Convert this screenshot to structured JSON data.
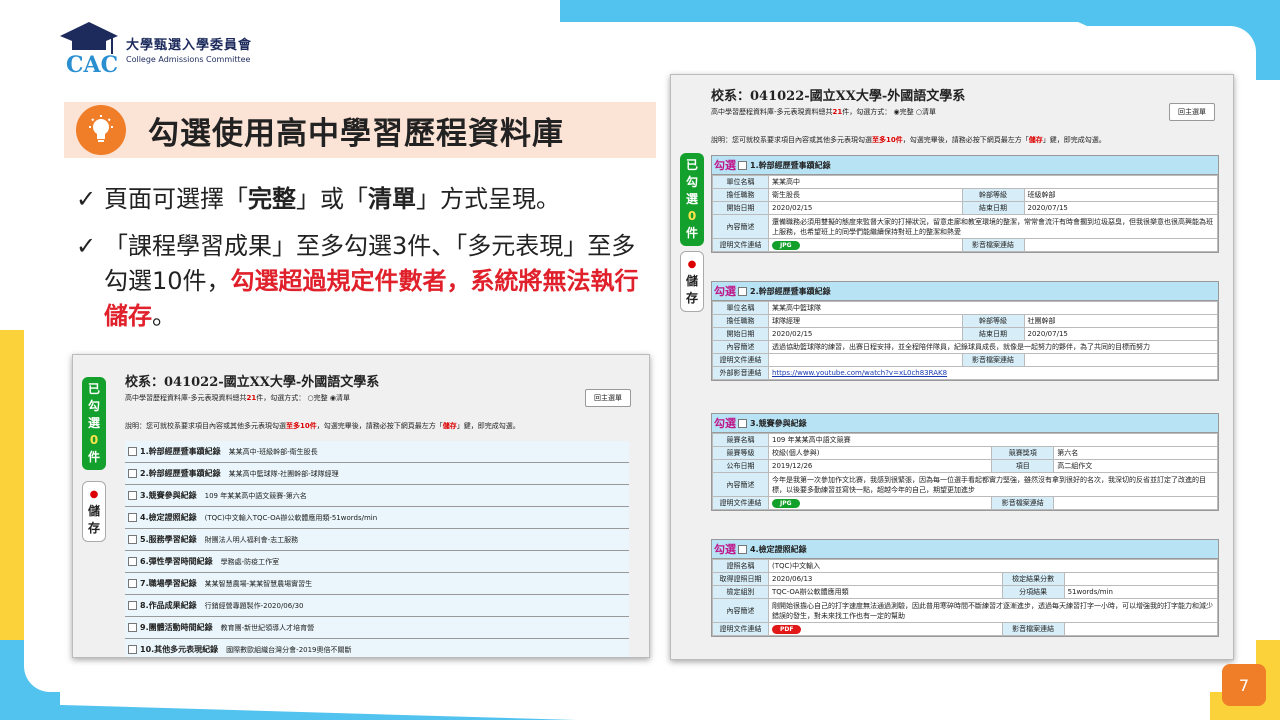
{
  "logo": {
    "zh": "大學甄選入學委員會",
    "en": "College Admissions Committee",
    "mark": "CAC"
  },
  "title": "勾選使用高中學習歷程資料庫",
  "bullets": {
    "b1_pre": "頁面可選擇「",
    "b1_a": "完整",
    "b1_mid": "」或「",
    "b1_b": "清單",
    "b1_post": "」方式呈現。",
    "b2_pre": "「課程學習成果」至多勾選3件、「多元表現」至多勾選10件，",
    "b2_red": "勾選超過規定件數者，系統將無法執行儲存",
    "b2_post": "。"
  },
  "side": {
    "selected_line1": "已",
    "selected_line2": "勾",
    "selected_line3": "選",
    "count": "0",
    "unit": "件",
    "save_dot": "●",
    "save1": "儲",
    "save2": "存"
  },
  "shot1": {
    "title": "校系：041022-國立XX大學-外國語文學系",
    "sub_pre": "高中學習歷程資料庫-多元表現資料總共",
    "sub_count": "21",
    "sub_post": "件，勾選方式：",
    "opt_full": "完整",
    "opt_list": "清單",
    "back": "回主選單",
    "note_pre": "說明：您可就校系要求項目內容或其他多元表現勾選",
    "note_red1": "至多10件",
    "note_mid": "，勾選完畢後，請務必按下網頁最左方「",
    "note_red2": "儲存",
    "note_post": "」鍵，即完成勾選。",
    "rows": [
      {
        "name": "1.幹部經歷暨事蹟紀錄",
        "desc": "某某高中-班級幹部-衛生股長"
      },
      {
        "name": "2.幹部經歷暨事蹟紀錄",
        "desc": "某某高中籃球隊-社團幹部-球隊經理"
      },
      {
        "name": "3.競賽參與紀錄",
        "desc": "109 年某某高中語文競賽-第六名"
      },
      {
        "name": "4.檢定證照紀錄",
        "desc": "(TQC)中文輸入TQC-OA辦公軟體應用類-51words/min"
      },
      {
        "name": "5.服務學習紀錄",
        "desc": "財團法人明人福利會-志工服務"
      },
      {
        "name": "6.彈性學習時間紀錄",
        "desc": "學務處-防疫工作室"
      },
      {
        "name": "7.職場學習紀錄",
        "desc": "某某智慧農場-某某智慧農場實習生"
      },
      {
        "name": "8.作品成果紀錄",
        "desc": "行銷經營專題製作-2020/06/30"
      },
      {
        "name": "9.團體活動時間紀錄",
        "desc": "教育團-新世紀領導人才培育營"
      },
      {
        "name": "10.其他多元表現紀錄",
        "desc": "國際數歐組織台灣分會-2019奧倍不關斷"
      }
    ]
  },
  "shot2": {
    "title": "校系：041022-國立XX大學-外國語文學系",
    "sub_pre": "高中學習歷程資料庫-多元表現資料總共",
    "sub_count": "21",
    "sub_post": "件，勾選方式：",
    "opt_full": "完整",
    "opt_list": "清單",
    "back": "回主選單",
    "note_pre": "說明：您可就校系要求項目內容或其他多元表現勾選",
    "note_red1": "至多10件",
    "note_mid": "，勾選完畢後，請務必按下網頁最左方「",
    "note_red2": "儲存",
    "note_post": "」鍵，即完成勾選。",
    "check_label": "勾選",
    "s1": {
      "head": "1.幹部經歷暨事蹟紀錄",
      "k_unit": "單位名稱",
      "v_unit": "某某高中",
      "k_role": "擔任職務",
      "v_role": "衛生股長",
      "k_level": "幹部等級",
      "v_level": "班級幹部",
      "k_start": "開始日期",
      "v_start": "2020/02/15",
      "k_end": "結束日期",
      "v_end": "2020/07/15",
      "k_desc": "內容簡述",
      "v_desc": "還備職務必須用雙擬的態度來監督大家的打掃狀況，留意走廊和教室環境的整潔，常常會流汗有時會擱到垃圾惡臭，但我很樂意也很高興能為班上服務，也希望班上的同學們能繼續保持對班上的整潔和熱愛",
      "k_doc": "證明文件連結",
      "v_doc": "JPG",
      "k_media": "影音檔案連結"
    },
    "s2": {
      "head": "2.幹部經歷暨事蹟紀錄",
      "k_unit": "單位名稱",
      "v_unit": "某某高中籃球隊",
      "k_role": "擔任職務",
      "v_role": "球隊經理",
      "k_level": "幹部等級",
      "v_level": "社團幹部",
      "k_start": "開始日期",
      "v_start": "2020/02/15",
      "k_end": "結束日期",
      "v_end": "2020/07/15",
      "k_desc": "內容簡述",
      "v_desc": "透過協助籃球隊的練習，出賽日程安排，並全程陪伴隊員，紀錄球員成長，就像是一起努力的夥伴，為了共同的目標而努力",
      "k_doc": "證明文件連結",
      "k_media": "影音檔案連結",
      "k_ext": "外部影音連結",
      "v_ext": "https://www.youtube.com/watch?v=xL0ch83RAK8"
    },
    "s3": {
      "head": "3.競賽參與紀錄",
      "k_name": "競賽名稱",
      "v_name": "109 年某某高中語文競賽",
      "k_level": "競賽等級",
      "v_level": "校級(個人參與)",
      "k_prize": "競賽獎項",
      "v_prize": "第六名",
      "k_date": "公布日期",
      "v_date": "2019/12/26",
      "k_item": "項目",
      "v_item": "高二組作文",
      "k_desc": "內容簡述",
      "v_desc": "今年是我第一次參加作文比賽，我感到很緊張，因為每一位選手看起都實力堅強，雖然沒有拿到很好的名次，我深切的反省並訂定了改進的目標，以後要多勤練習並寫快一點，超越今年的自己，期望更加進步",
      "k_doc": "證明文件連結",
      "v_doc": "JPG",
      "k_media": "影音檔案連結"
    },
    "s4": {
      "head": "4.檢定證照紀錄",
      "k_name": "證照名稱",
      "v_name": "(TQC)中文輸入",
      "k_date": "取得證照日期",
      "v_date": "2020/06/13",
      "k_score": "檢定結果分數",
      "k_group": "檢定組別",
      "v_group": "TQC-OA辦公軟體應用類",
      "k_level": "分項結果",
      "v_level": "51words/min",
      "k_desc": "內容簡述",
      "v_desc": "剛開始很擔心自己的打字速度無法通過測驗，因此普用寒碎時間不斷練習才逐漸進步，透過每天練習打字一小時，可以增強我的打字能力和減少錯誤的發生，對未來找工作也有一定的幫助",
      "k_doc": "證明文件連結",
      "v_doc": "PDF",
      "k_media": "影音檔案連結"
    }
  },
  "page_number": "7",
  "colors": {
    "accent": "#f07d28",
    "blue": "#52c3ef",
    "yellow": "#fcd23a",
    "red": "#e0202a",
    "green": "#14a02c"
  }
}
